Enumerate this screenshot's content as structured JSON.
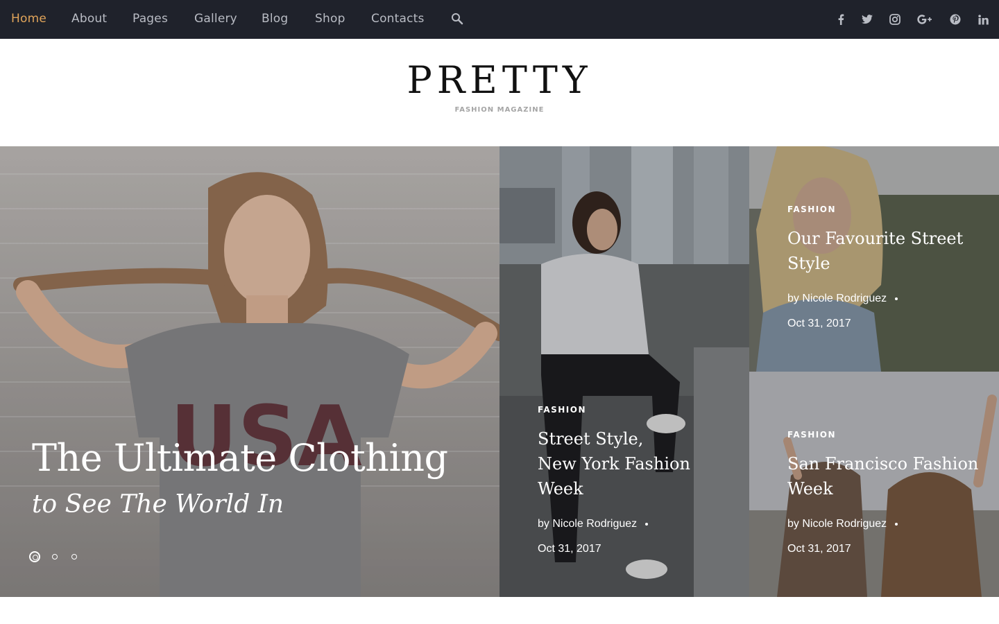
{
  "nav": {
    "items": [
      {
        "label": "Home",
        "active": true
      },
      {
        "label": "About",
        "active": false
      },
      {
        "label": "Pages",
        "active": false
      },
      {
        "label": "Gallery",
        "active": false
      },
      {
        "label": "Blog",
        "active": false
      },
      {
        "label": "Shop",
        "active": false
      },
      {
        "label": "Contacts",
        "active": false
      }
    ],
    "search_icon": "search-icon",
    "social_icons": [
      "facebook-icon",
      "twitter-icon",
      "instagram-icon",
      "google-plus-icon",
      "pinterest-icon",
      "linkedin-icon"
    ]
  },
  "brand": {
    "logo": "PRETTY",
    "tagline": "FASHION MAGAZINE"
  },
  "hero": {
    "title": "The Ultimate Clothing",
    "subtitle": "to See The World In",
    "slides": 3,
    "active_slide": 1
  },
  "posts": [
    {
      "category": "FASHION",
      "title_line1": "Street Style,",
      "title_line2": "New York Fashion",
      "title_line3": "Week",
      "author": "by Nicole Rodriguez",
      "date": "Oct 31, 2017"
    },
    {
      "category": "FASHION",
      "title_line1": "Our Favourite Street",
      "title_line2": "Style",
      "author": "by Nicole Rodriguez",
      "date": "Oct 31, 2017"
    },
    {
      "category": "FASHION",
      "title_line1": "San Francisco Fashion",
      "title_line2": "Week",
      "author": "by Nicole Rodriguez",
      "date": "Oct 31, 2017"
    }
  ],
  "colors": {
    "topbar": "#1f222b",
    "nav_text": "#b9bcc4",
    "nav_active": "#e0a45a"
  }
}
